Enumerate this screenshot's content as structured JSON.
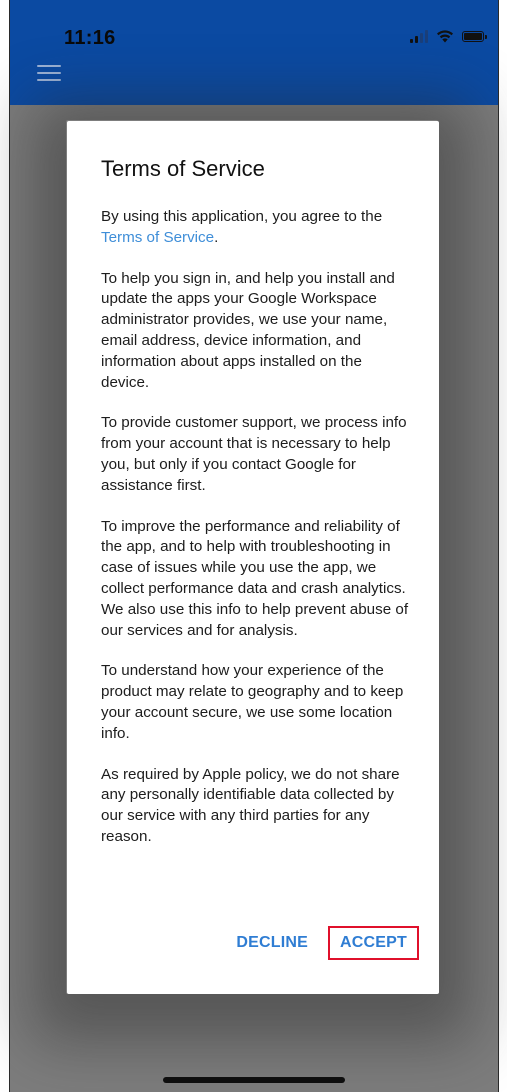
{
  "status_bar": {
    "time": "11:16",
    "icons": [
      "signal-icon",
      "wifi-icon",
      "battery-icon"
    ]
  },
  "toolbar": {
    "menu_icon": "hamburger-menu-icon",
    "color": "#0b4aa2"
  },
  "dialog": {
    "title": "Terms of Service",
    "intro_prefix": "By using this application, you agree to the ",
    "intro_link": "Terms of Service",
    "intro_suffix": ".",
    "paragraphs": [
      "To help you sign in, and help you install and update the apps your Google Workspace administrator provides, we use your name, email address, device information, and information about apps installed on the device.",
      "To provide customer support, we process info from your account that is necessary to help you, but only if you contact Google for assistance first.",
      "To improve the performance and reliability of the app, and to help with troubleshooting in case of issues while you use the app, we collect performance data and crash analytics. We also use this info to help prevent abuse of our services and for analysis.",
      "To understand how your experience of the product may relate to geography and to keep your account secure, we use some location info.",
      "As required by Apple policy, we do not share any personally identifiable data collected by our service with any third parties for any reason."
    ],
    "decline_label": "DECLINE",
    "accept_label": "ACCEPT"
  },
  "colors": {
    "accent": "#2f7dd3",
    "link": "#3f8ed8",
    "highlight_border": "#e0102b",
    "scrim": "#7d7d7d"
  }
}
